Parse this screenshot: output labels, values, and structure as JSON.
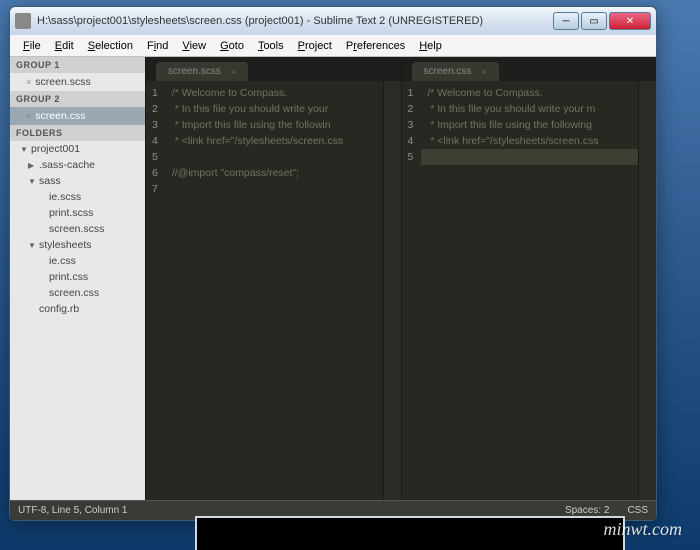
{
  "window": {
    "title": "H:\\sass\\project001\\stylesheets\\screen.css (project001) - Sublime Text 2 (UNREGISTERED)"
  },
  "menu": [
    "File",
    "Edit",
    "Selection",
    "Find",
    "View",
    "Goto",
    "Tools",
    "Project",
    "Preferences",
    "Help"
  ],
  "sidebar": {
    "group1_label": "GROUP 1",
    "group1_file": "screen.scss",
    "group2_label": "GROUP 2",
    "group2_file": "screen.css",
    "folders_label": "FOLDERS",
    "tree": {
      "root": "project001",
      "sass_cache": ".sass-cache",
      "sass": "sass",
      "sass_files": [
        "ie.scss",
        "print.scss",
        "screen.scss"
      ],
      "stylesheets": "stylesheets",
      "stylesheets_files": [
        "ie.css",
        "print.css",
        "screen.css"
      ],
      "config": "config.rb"
    }
  },
  "panes": {
    "left": {
      "tab": "screen.scss",
      "lines": [
        "/* Welcome to Compass.",
        " * In this file you should write your ",
        " * Import this file using the followin",
        " * <link href=\"/stylesheets/screen.css",
        "",
        "//@import \"compass/reset\";",
        ""
      ],
      "line_numbers": [
        "1",
        "2",
        "3",
        "4",
        "5",
        "6",
        "7"
      ]
    },
    "right": {
      "tab": "screen.css",
      "lines": [
        "/* Welcome to Compass.",
        " * In this file you should write your m",
        " * Import this file using the following",
        " * <link href=\"/stylesheets/screen.css",
        ""
      ],
      "line_numbers": [
        "1",
        "2",
        "3",
        "4",
        "5"
      ],
      "highlight_line": 5
    }
  },
  "status": {
    "left": "UTF-8, Line 5, Column 1",
    "spaces": "Spaces: 2",
    "lang": "CSS"
  },
  "watermark": "minwt.com"
}
